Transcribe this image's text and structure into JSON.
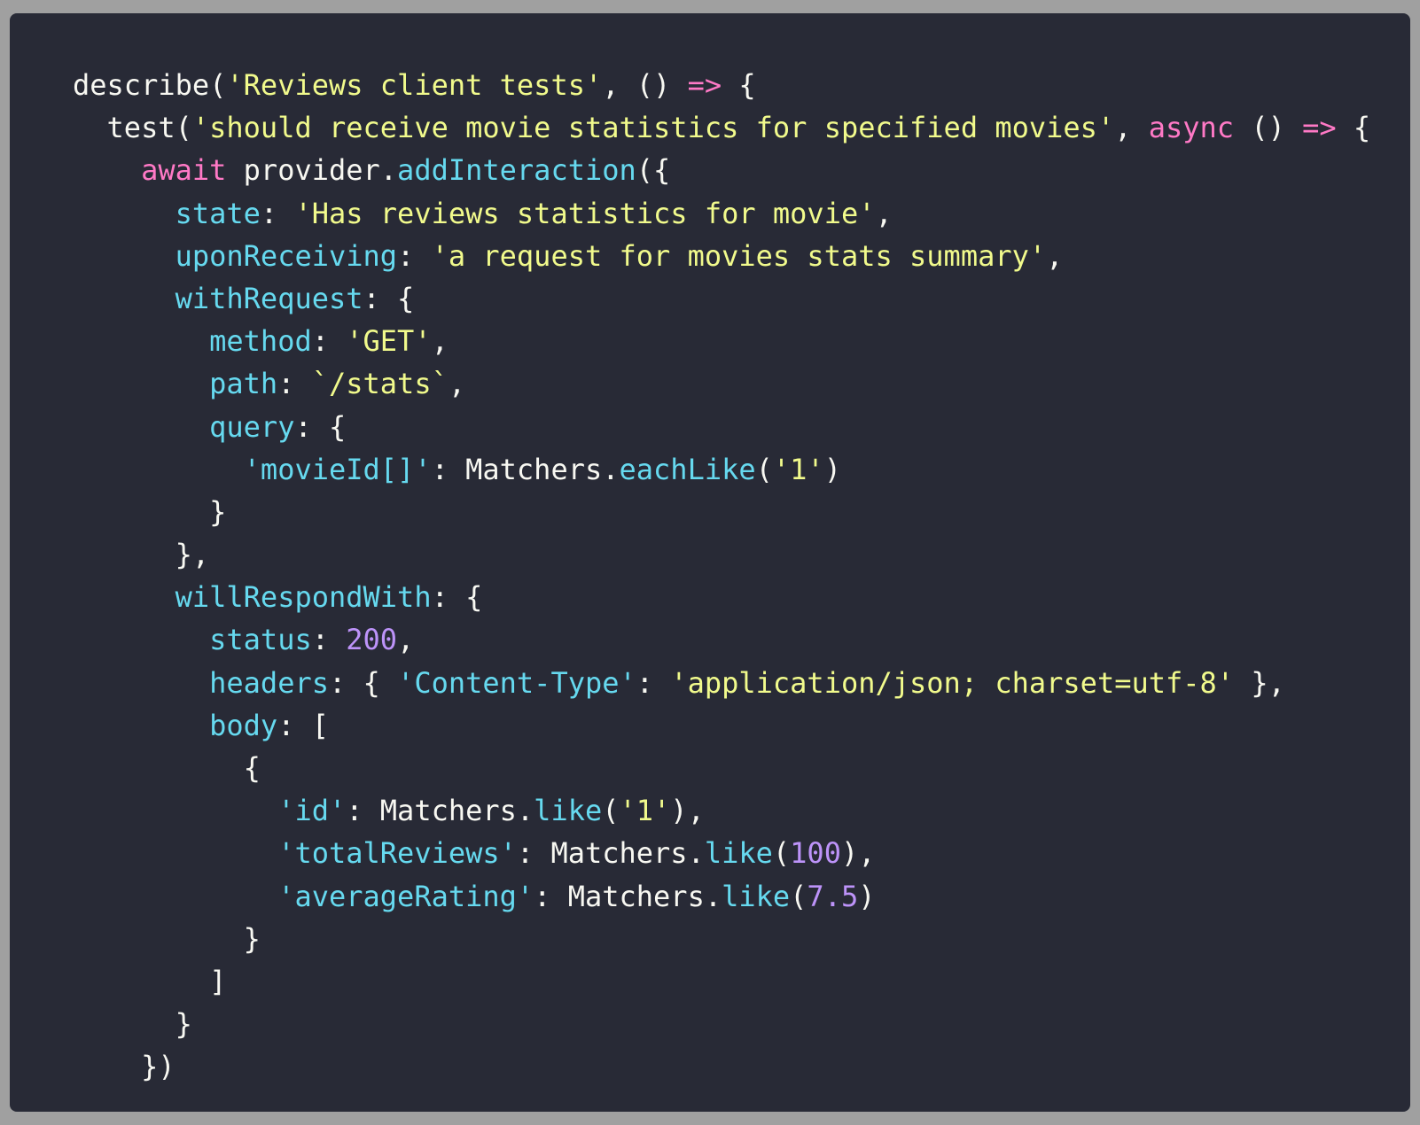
{
  "colors": {
    "background_outer": "#a0a0a0",
    "editor_bg": "#282a36",
    "plain": "#f8f8f2",
    "string": "#f1fa8c",
    "keyword": "#ff79c6",
    "property": "#66d9ef",
    "number": "#bd93f9"
  },
  "code": {
    "lines": [
      [
        [
          "p",
          "describe("
        ],
        [
          "s",
          "'Reviews client tests'"
        ],
        [
          "p",
          ", () "
        ],
        [
          "k",
          "=>"
        ],
        [
          "p",
          " {"
        ]
      ],
      [
        [
          "p",
          "  test("
        ],
        [
          "s",
          "'should receive movie statistics for specified movies'"
        ],
        [
          "p",
          ", "
        ],
        [
          "k",
          "async"
        ],
        [
          "p",
          " () "
        ],
        [
          "k",
          "=>"
        ],
        [
          "p",
          " {"
        ]
      ],
      [
        [
          "k",
          "    await"
        ],
        [
          "p",
          " provider."
        ],
        [
          "fn",
          "addInteraction"
        ],
        [
          "p",
          "({"
        ]
      ],
      [
        [
          "prop",
          "      state"
        ],
        [
          "p",
          ": "
        ],
        [
          "s",
          "'Has reviews statistics for movie'"
        ],
        [
          "p",
          ","
        ]
      ],
      [
        [
          "prop",
          "      uponReceiving"
        ],
        [
          "p",
          ": "
        ],
        [
          "s",
          "'a request for movies stats summary'"
        ],
        [
          "p",
          ","
        ]
      ],
      [
        [
          "prop",
          "      withRequest"
        ],
        [
          "p",
          ": {"
        ]
      ],
      [
        [
          "prop",
          "        method"
        ],
        [
          "p",
          ": "
        ],
        [
          "s",
          "'GET'"
        ],
        [
          "p",
          ","
        ]
      ],
      [
        [
          "prop",
          "        path"
        ],
        [
          "p",
          ": "
        ],
        [
          "s",
          "`/stats`"
        ],
        [
          "p",
          ","
        ]
      ],
      [
        [
          "prop",
          "        query"
        ],
        [
          "p",
          ": {"
        ]
      ],
      [
        [
          "key",
          "          'movieId[]'"
        ],
        [
          "p",
          ": Matchers."
        ],
        [
          "fn",
          "eachLike"
        ],
        [
          "p",
          "("
        ],
        [
          "s",
          "'1'"
        ],
        [
          "p",
          ")"
        ]
      ],
      [
        [
          "p",
          "        }"
        ]
      ],
      [
        [
          "p",
          "      },"
        ]
      ],
      [
        [
          "prop",
          "      willRespondWith"
        ],
        [
          "p",
          ": {"
        ]
      ],
      [
        [
          "prop",
          "        status"
        ],
        [
          "p",
          ": "
        ],
        [
          "n",
          "200"
        ],
        [
          "p",
          ","
        ]
      ],
      [
        [
          "prop",
          "        headers"
        ],
        [
          "p",
          ": { "
        ],
        [
          "key",
          "'Content-Type'"
        ],
        [
          "p",
          ": "
        ],
        [
          "s",
          "'application/json; charset=utf-8'"
        ],
        [
          "p",
          " },"
        ]
      ],
      [
        [
          "prop",
          "        body"
        ],
        [
          "p",
          ": ["
        ]
      ],
      [
        [
          "p",
          "          {"
        ]
      ],
      [
        [
          "key",
          "            'id'"
        ],
        [
          "p",
          ": Matchers."
        ],
        [
          "fn",
          "like"
        ],
        [
          "p",
          "("
        ],
        [
          "s",
          "'1'"
        ],
        [
          "p",
          "),"
        ]
      ],
      [
        [
          "key",
          "            'totalReviews'"
        ],
        [
          "p",
          ": Matchers."
        ],
        [
          "fn",
          "like"
        ],
        [
          "p",
          "("
        ],
        [
          "n",
          "100"
        ],
        [
          "p",
          "),"
        ]
      ],
      [
        [
          "key",
          "            'averageRating'"
        ],
        [
          "p",
          ": Matchers."
        ],
        [
          "fn",
          "like"
        ],
        [
          "p",
          "("
        ],
        [
          "n",
          "7.5"
        ],
        [
          "p",
          ")"
        ]
      ],
      [
        [
          "p",
          "          }"
        ]
      ],
      [
        [
          "p",
          "        ]"
        ]
      ],
      [
        [
          "p",
          "      }"
        ]
      ],
      [
        [
          "p",
          "    })"
        ]
      ]
    ]
  }
}
